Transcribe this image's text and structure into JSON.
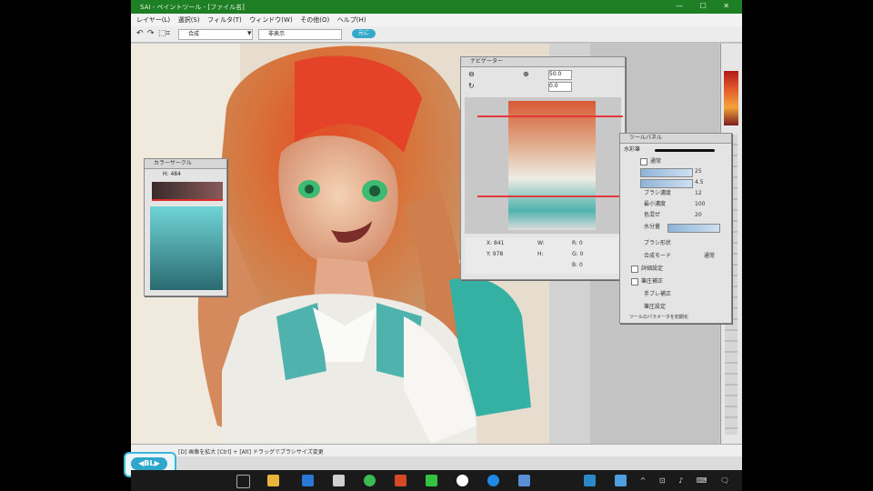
{
  "app": {
    "title": "SAI - ペイントツール - [ファイル名]"
  },
  "window_controls": "— ☐ ✕",
  "menu": {
    "items": [
      "レイヤー(L)",
      "選択(S)",
      "フィルタ(T)",
      "ウィンドウ(W)",
      "その他(O)",
      "ヘルプ(H)"
    ]
  },
  "toolbar": {
    "select_mode": "合成",
    "sub_mode": "非表示",
    "pill_label": "元に"
  },
  "navigator": {
    "title": "ナビゲーター",
    "zoom": "50.0",
    "angle": "0.0",
    "readout": [
      "X: 841",
      "Y: 978",
      "W:",
      "H:",
      "R: 0",
      "G: 0",
      "B: 0"
    ]
  },
  "color_panel": {
    "title": "カラーサークル",
    "value_label": "H: 484"
  },
  "brush_panel": {
    "title": "ツールパネル",
    "preset": "水彩筆",
    "rows": [
      "通常",
      "サイズ",
      "最小サイズ",
      "ブラシ濃度",
      "最小濃度",
      "色混ぜ",
      "水分量",
      "ブラシ形状",
      "合成モード",
      "詳細設定",
      "筆圧補正",
      "色の延び",
      "手ブレ補正",
      "筆圧設定"
    ],
    "values": [
      "25",
      "4.5",
      "12",
      "100",
      "20",
      "50",
      "0",
      "通常"
    ],
    "footer": "ツールのパラメータを初期化"
  },
  "status": {
    "text": "[D] 画像を拡大 [Ctrl] + [Alt] ドラッグでブラシサイズ変更"
  },
  "back_button": {
    "label": "◀BL▶"
  },
  "colors": {
    "accent": "#35a9c9",
    "titlebar": "#1e7f24",
    "taskbar": "#1a1a1a"
  },
  "taskbar": {
    "icons": [
      "search-icon",
      "task-view-icon",
      "explorer-icon",
      "store-icon",
      "chrome-icon",
      "app-icon",
      "line-icon",
      "google-icon",
      "app-icon",
      "settings-icon",
      "sai-icon",
      "app-icon"
    ],
    "tray": "^ ⊡ ♪ ⌨ 🗨"
  }
}
